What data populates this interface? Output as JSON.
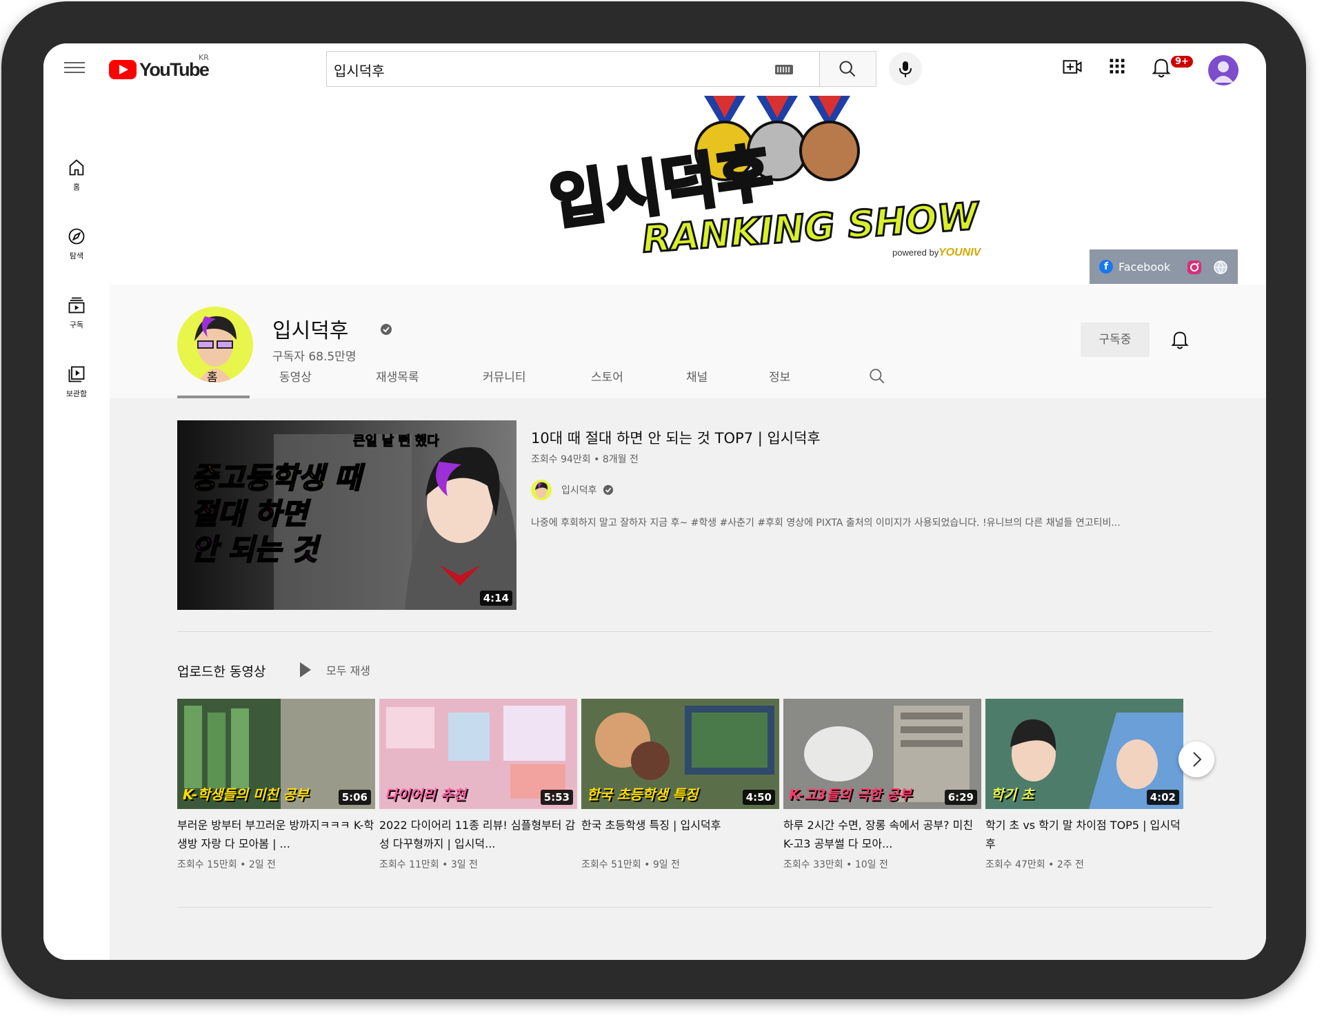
{
  "topbar": {
    "logo_text": "YouTube",
    "logo_country": "KR",
    "search_value": "입시덕후",
    "notification_count": "9+"
  },
  "sidebar": {
    "items": [
      {
        "label": "홈",
        "icon": "home-icon"
      },
      {
        "label": "탐색",
        "icon": "compass-icon"
      },
      {
        "label": "구독",
        "icon": "subscriptions-icon"
      },
      {
        "label": "보관함",
        "icon": "library-icon"
      }
    ]
  },
  "banner": {
    "title_korean": "입시덕후",
    "title_english": "RANKING SHOW",
    "powered_by": "powered by",
    "brand": "YOUNIV",
    "facebook_label": "Facebook"
  },
  "channel": {
    "name": "입시덕후",
    "subscribers": "구독자 68.5만명",
    "subscribe_label": "구독중"
  },
  "tabs": [
    {
      "label": "홈",
      "active": true
    },
    {
      "label": "동영상",
      "active": false
    },
    {
      "label": "재생목록",
      "active": false
    },
    {
      "label": "커뮤니티",
      "active": false
    },
    {
      "label": "스토어",
      "active": false
    },
    {
      "label": "채널",
      "active": false
    },
    {
      "label": "정보",
      "active": false
    }
  ],
  "featured": {
    "title": "10대 때 절대 하면 안 되는 것 TOP7 | 입시덕후",
    "meta": "조회수 94만회 • 8개월 전",
    "channel_name": "입시덕후",
    "description": "나중에 후회하지 말고 잘하자 지금 후~ #학생 #사춘기 #후회 영상에 PIXTA 출처의 이미지가 사용되었습니다. !유니브의 다른 채널들 연고티비...",
    "duration": "4:14",
    "thumb_line1": "중고등학생 때",
    "thumb_line2": "절대 하면",
    "thumb_line3": "안 되는 것",
    "thumb_speech": "큰일 날 뻔 했다"
  },
  "shelf": {
    "title": "업로드한 동영상",
    "play_all": "모두 재생",
    "videos": [
      {
        "title": "부러운 방부터 부끄러운 방까지ㅋㅋㅋ K-학생방 자랑 다 모아봄 | ...",
        "meta": "조회수 15만회 • 2일 전",
        "duration": "5:06",
        "caption": "K-학생들의 미친 공부",
        "bg": "#3c5a3a"
      },
      {
        "title": "2022 다이어리 11종 리뷰! 심플형부터 감성 다꾸형까지 | 입시덕...",
        "meta": "조회수 11만회 • 3일 전",
        "duration": "5:53",
        "caption": "다이어리 추천",
        "bg": "#e7b7c8"
      },
      {
        "title": "한국 초등학생 특징 | 입시덕후",
        "meta": "조회수 51만회 • 9일 전",
        "duration": "4:50",
        "caption": "한국 초등학생 특징",
        "bg": "#5b6e4a"
      },
      {
        "title": "하루 2시간 수면, 장롱 속에서 공부? 미친 K-고3 공부썰 다 모아...",
        "meta": "조회수 33만회 • 10일 전",
        "duration": "6:29",
        "caption": "K-고3들의 극한 공부",
        "bg": "#8a8a86"
      },
      {
        "title": "학기 초 vs 학기 말 차이점 TOP5 | 입시덕후",
        "meta": "조회수 47만회 • 2주 전",
        "duration": "4:02",
        "caption": "학기 초",
        "bg": "#4d7d6a"
      }
    ]
  }
}
